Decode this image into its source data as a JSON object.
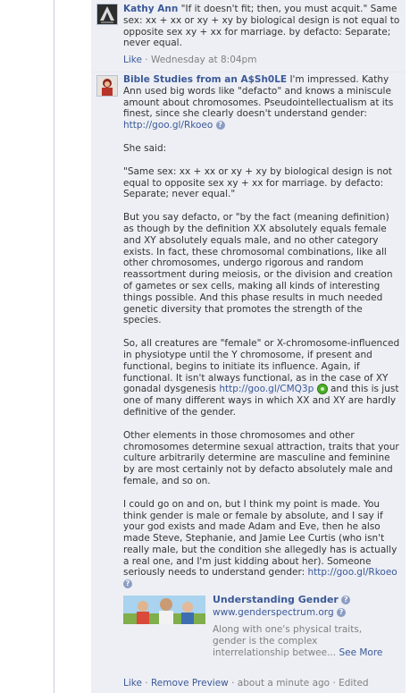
{
  "comment1": {
    "author": "Kathy Ann",
    "text": "\"If it doesn't fit; then, you must acquit.\" Same sex: xx + xx or xy + xy by biological design is not equal to opposite sex xy + xx for marriage. by defacto: Separate; never equal.",
    "like": "Like",
    "sep": " · ",
    "time": "Wednesday at 8:04pm"
  },
  "comment2": {
    "author": "Bible Studies from an A$Sh0LE",
    "p1_text": " I'm impressed. Kathy Ann used big words like \"defacto\" and knows a miniscule amount about chromosomes. Pseudointellectualism at its finest, since she clearly doesn't understand gender: ",
    "p1_link": "http://goo.gl/Rkoeo",
    "p2": "She said:",
    "p3": "\"Same sex: xx + xx or xy + xy by biological design is not equal to opposite sex xy + xx for marriage. by defacto: Separate; never equal.\"",
    "p4": "But you say defacto, or \"by the fact (meaning definition) as though by the definition XX absolutely equals female and XY absolutely equals male, and no other category exists. In fact, these chromosomal combinations, like all other chromosomes, undergo rigorous and random reassortment during meiosis, or the division and creation of gametes or sex cells, making all kinds of interesting things possible. And this phase results in much needed genetic diversity that promotes the strength of the species.",
    "p5_text": "So, all creatures are \"female\" or X-chromosome-influenced in physiotype until the Y chromosome, if present and functional, begins to initiate its influence. Again, if functional. It isn't always functional, as in the case of XY gonadal dysgenesis ",
    "p5_link": "http://goo.gl/CMQ3p",
    "p5_tail": " and this is just one of many different ways in which XX and XY are hardly definitive of the gender.",
    "p6": "Other elements in those chromosomes and other chromosomes determine sexual attraction, traits that your culture arbitrarily determine are masculine and feminine by are most certainly not by defacto absolutely male and female, and so on.",
    "p7_text": "I could go on and on, but I think my point is made. You think gender is male or female by absolute, and I say if your god exists and made Adam and Eve, then he also made Steve, Stephanie, and Jamie Lee Curtis (who isn't really male, but the condition she allegedly has is actually a real one, and I'm just kidding about her). Someone seriously needs to understand gender: ",
    "p7_link": "http://goo.gl/Rkoeo",
    "preview": {
      "title": "Understanding Gender",
      "domain": "www.genderspectrum.org",
      "desc": "Along with one's physical traits, gender is the complex interrelationship betwee... ",
      "see_more": "See More"
    },
    "actions": {
      "like": "Like",
      "remove_preview": "Remove Preview",
      "time": "about a minute ago",
      "edited": "Edited",
      "sep": " · "
    }
  },
  "info_glyph": "?",
  "colors": {
    "link": "#3b5998",
    "comment_bg": "#edeff4",
    "muted": "#808080"
  }
}
